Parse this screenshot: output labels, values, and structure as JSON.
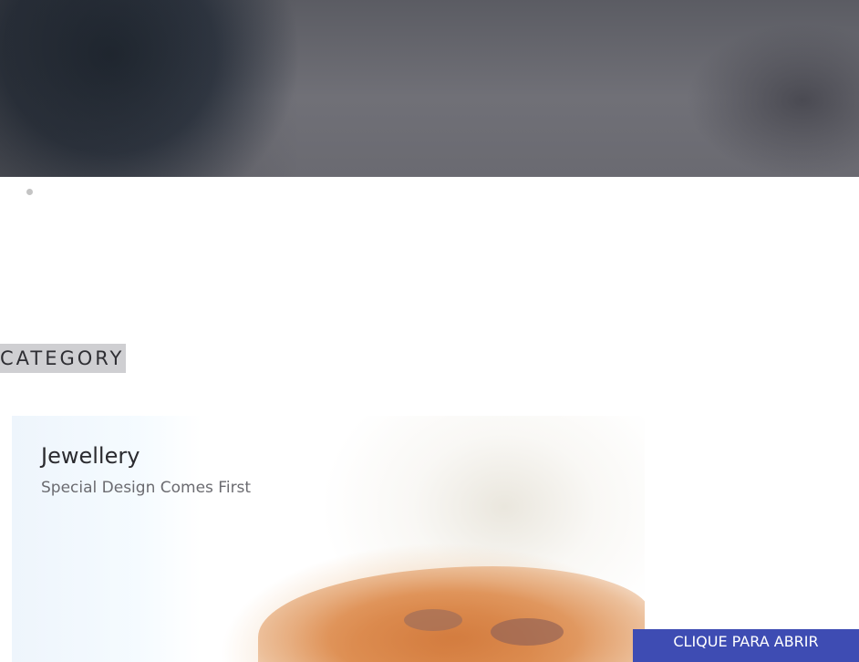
{
  "hero": {
    "slider": {
      "dots": 1,
      "active_index": 0
    }
  },
  "category_section": {
    "heading": "CATEGORY",
    "cards": [
      {
        "title": "Jewellery",
        "subtitle": "Special Design Comes First"
      }
    ]
  },
  "floating_button": {
    "label": "CLIQUE PARA ABRIR",
    "color": "#3e4cb3"
  }
}
